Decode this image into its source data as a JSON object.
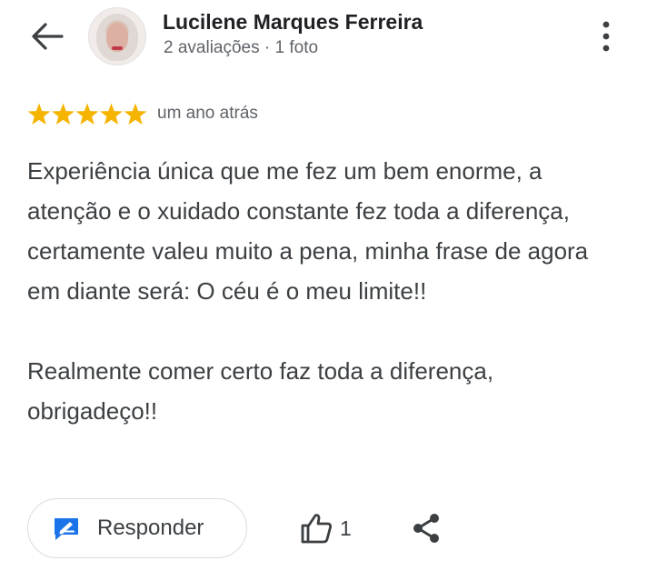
{
  "header": {
    "back_icon": "arrow-back-icon",
    "name": "Lucilene Marques Ferreira",
    "meta": "2 avaliações · 1 foto",
    "more_icon": "more-vert-icon"
  },
  "rating": {
    "stars": 5,
    "max_stars": 5,
    "star_color": "#f4b400",
    "time": "um ano atrás"
  },
  "review": {
    "text": "Experiência única que me fez um bem enorme, a atenção e o xuidado constante fez toda a diferença, certamente valeu muito a pena, minha frase de agora em diante será: O céu é o meu limite!!\n\nRealmente comer certo faz toda a diferença, obrigadeço!!"
  },
  "actions": {
    "reply_label": "Responder",
    "reply_icon": "reply-edit-icon",
    "like_icon": "thumb-up-icon",
    "like_count": "1",
    "share_icon": "share-icon"
  },
  "colors": {
    "accent": "#1a73e8",
    "text_primary": "#202124",
    "text_secondary": "#5f6368"
  }
}
